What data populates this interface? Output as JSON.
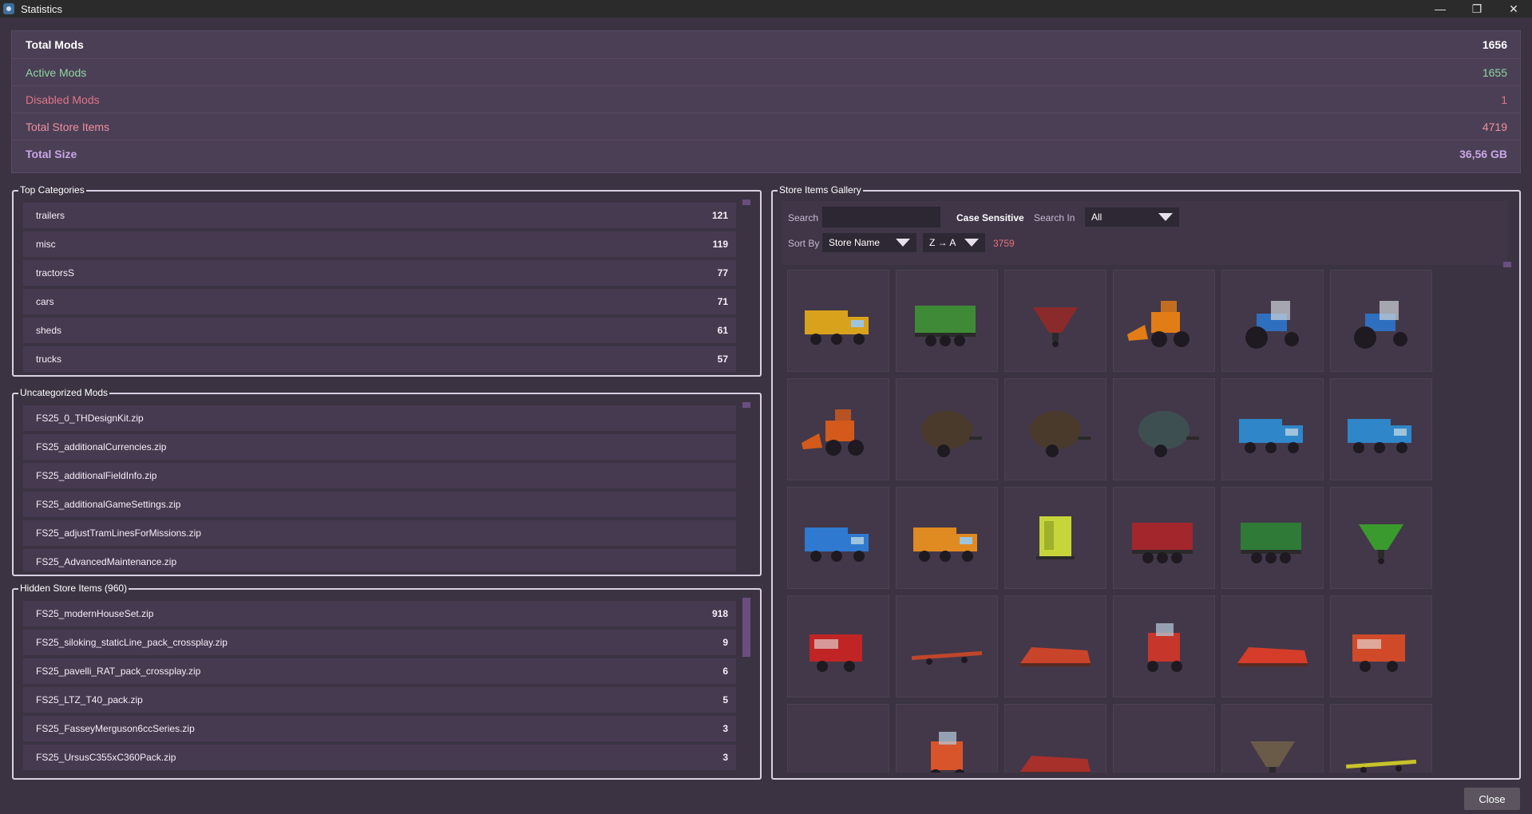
{
  "window": {
    "title": "Statistics",
    "controls": {
      "minimize": "—",
      "restore": "❐",
      "close": "✕"
    }
  },
  "stats": [
    {
      "label": "Total Mods",
      "value": "1656",
      "color": "#ffffff"
    },
    {
      "label": "Active Mods",
      "value": "1655",
      "color": "#8ed6a3"
    },
    {
      "label": "Disabled Mods",
      "value": "1",
      "color": "#e07488"
    },
    {
      "label": "Total Store Items",
      "value": "4719",
      "color": "#f08fa0"
    },
    {
      "label": "Total Size",
      "value": "36,56 GB",
      "color": "#c9a8e6"
    }
  ],
  "top_categories": {
    "title": "Top Categories",
    "items": [
      {
        "name": "trailers",
        "count": "121"
      },
      {
        "name": "misc",
        "count": "119"
      },
      {
        "name": "tractorsS",
        "count": "77"
      },
      {
        "name": "cars",
        "count": "71"
      },
      {
        "name": "sheds",
        "count": "61"
      },
      {
        "name": "trucks",
        "count": "57"
      }
    ]
  },
  "uncategorized": {
    "title": "Uncategorized Mods",
    "items": [
      "FS25_0_THDesignKit.zip",
      "FS25_additionalCurrencies.zip",
      "FS25_additionalFieldInfo.zip",
      "FS25_additionalGameSettings.zip",
      "FS25_adjustTramLinesForMissions.zip",
      "FS25_AdvancedMaintenance.zip"
    ]
  },
  "hidden": {
    "title": "Hidden Store Items (960)",
    "items": [
      {
        "name": "FS25_modernHouseSet.zip",
        "count": "918"
      },
      {
        "name": "FS25_siloking_staticLine_pack_crossplay.zip",
        "count": "9"
      },
      {
        "name": "FS25_pavelli_RAT_pack_crossplay.zip",
        "count": "6"
      },
      {
        "name": "FS25_LTZ_T40_pack.zip",
        "count": "5"
      },
      {
        "name": "FS25_FasseyMerguson6ccSeries.zip",
        "count": "3"
      },
      {
        "name": "FS25_UrsusC355xC360Pack.zip",
        "count": "3"
      }
    ]
  },
  "gallery": {
    "title": "Store Items Gallery",
    "search_label": "Search",
    "search_value": "",
    "case_sensitive_label": "Case Sensitive",
    "search_in_label": "Search In",
    "search_in_value": "All",
    "sort_by_label": "Sort By",
    "sort_by_value": "Store Name",
    "order_value": "Z → A",
    "result_count": "3759",
    "items": [
      {
        "kind": "truck",
        "color": "#d9a21c"
      },
      {
        "kind": "wagon",
        "color": "#3f8a36"
      },
      {
        "kind": "spreader",
        "color": "#8a2a2a"
      },
      {
        "kind": "loader",
        "color": "#e27c16"
      },
      {
        "kind": "tractor",
        "color": "#2f6fc0"
      },
      {
        "kind": "tractor",
        "color": "#2f6fc0"
      },
      {
        "kind": "loader",
        "color": "#d35a1b"
      },
      {
        "kind": "tank",
        "color": "#4a3a2c"
      },
      {
        "kind": "tank",
        "color": "#4a3a2c"
      },
      {
        "kind": "tank",
        "color": "#3e4f52"
      },
      {
        "kind": "truck",
        "color": "#2f86c9"
      },
      {
        "kind": "truck",
        "color": "#2f86c9"
      },
      {
        "kind": "truck",
        "color": "#2f7ad0"
      },
      {
        "kind": "truck",
        "color": "#e08a22"
      },
      {
        "kind": "sprayer",
        "color": "#c6d63a"
      },
      {
        "kind": "wagon",
        "color": "#a2262c"
      },
      {
        "kind": "wagon",
        "color": "#2f7a36"
      },
      {
        "kind": "spreader",
        "color": "#3a9a2e"
      },
      {
        "kind": "baler",
        "color": "#c02424"
      },
      {
        "kind": "bar",
        "color": "#c0462a"
      },
      {
        "kind": "header",
        "color": "#c8442a"
      },
      {
        "kind": "harvester",
        "color": "#c6362a"
      },
      {
        "kind": "header",
        "color": "#d63c2a"
      },
      {
        "kind": "baler",
        "color": "#d04a2a"
      },
      {
        "kind": "empty",
        "color": "#433849"
      },
      {
        "kind": "harvester",
        "color": "#d8542a"
      },
      {
        "kind": "header",
        "color": "#a8302a"
      },
      {
        "kind": "empty",
        "color": "#433849"
      },
      {
        "kind": "spreader",
        "color": "#6a5a48"
      },
      {
        "kind": "bar",
        "color": "#c8c22a"
      }
    ]
  },
  "close_label": "Close"
}
